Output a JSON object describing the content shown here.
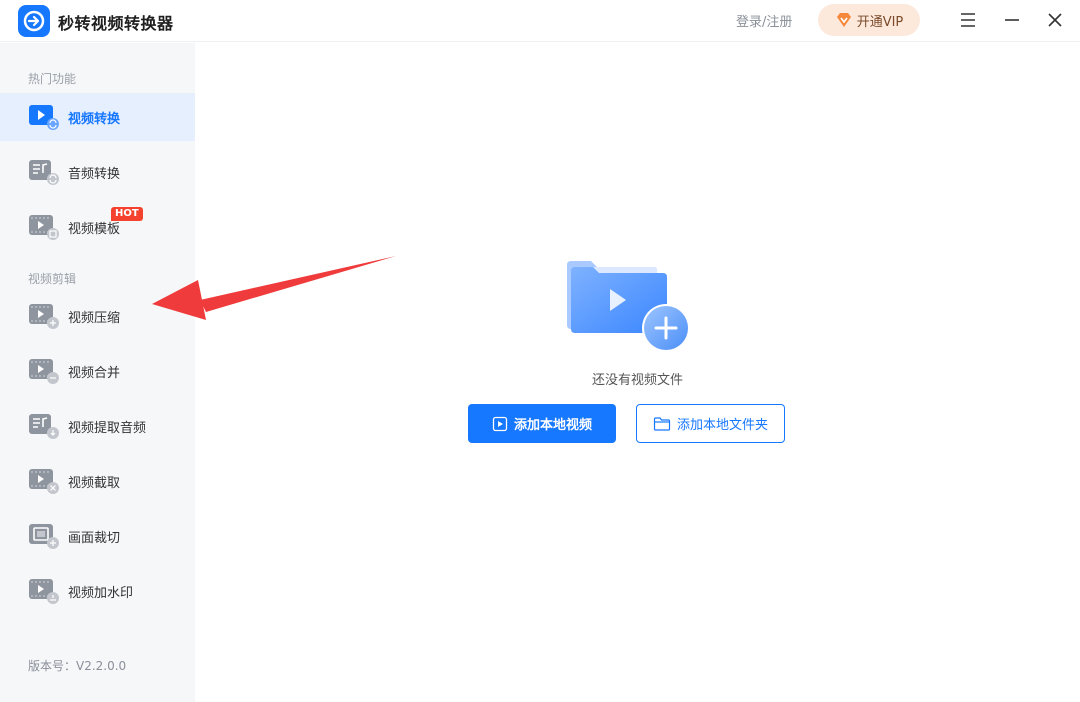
{
  "app": {
    "title": "秒转视频转换器",
    "login": "登录/注册",
    "vip_label": "开通VIP",
    "accent": "#1677ff"
  },
  "sidebar": {
    "section_hot": "热门功能",
    "section_edit": "视频剪辑",
    "items": [
      {
        "label": "视频转换",
        "icon": "video-convert-icon",
        "active": true
      },
      {
        "label": "音频转换",
        "icon": "audio-convert-icon"
      },
      {
        "label": "视频模板",
        "icon": "video-template-icon",
        "badge": "HOT"
      },
      {
        "label": "视频压缩",
        "icon": "video-compress-icon"
      },
      {
        "label": "视频合并",
        "icon": "video-merge-icon"
      },
      {
        "label": "视频提取音频",
        "icon": "extract-audio-icon"
      },
      {
        "label": "视频截取",
        "icon": "video-cut-icon"
      },
      {
        "label": "画面裁切",
        "icon": "crop-icon"
      },
      {
        "label": "视频加水印",
        "icon": "watermark-icon"
      }
    ],
    "version": "版本号：V2.2.0.0"
  },
  "main": {
    "empty_text": "还没有视频文件",
    "add_video": "添加本地视频",
    "add_folder": "添加本地文件夹"
  }
}
